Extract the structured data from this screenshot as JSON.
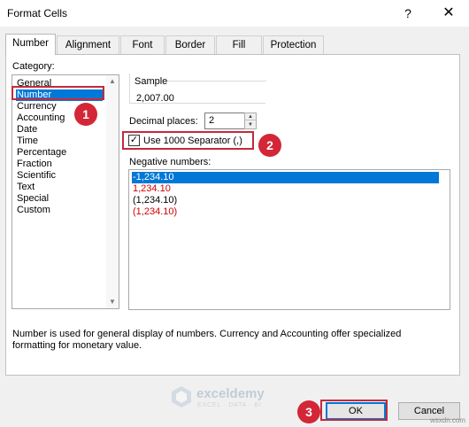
{
  "dialog": {
    "title": "Format Cells",
    "help": "?",
    "close": "✕"
  },
  "tabs": [
    {
      "label": "Number"
    },
    {
      "label": "Alignment"
    },
    {
      "label": "Font"
    },
    {
      "label": "Border"
    },
    {
      "label": "Fill"
    },
    {
      "label": "Protection"
    }
  ],
  "category": {
    "label": "Category:",
    "items": [
      "General",
      "Number",
      "Currency",
      "Accounting",
      "Date",
      "Time",
      "Percentage",
      "Fraction",
      "Scientific",
      "Text",
      "Special",
      "Custom"
    ],
    "selected": "Number"
  },
  "sample": {
    "label": "Sample",
    "value": "2,007.00"
  },
  "decimal": {
    "label": "Decimal places:",
    "value": "2"
  },
  "separator": {
    "label": "Use 1000 Separator (,)",
    "checked": true,
    "check_mark": "✓"
  },
  "negative": {
    "label": "Negative numbers:",
    "items": [
      "-1,234.10",
      "1,234.10",
      "(1,234.10)",
      "(1,234.10)"
    ],
    "selected_index": 0
  },
  "description": {
    "line1": "Number is used for general display of numbers.  Currency and Accounting offer specialized",
    "line2": "formatting for monetary value."
  },
  "buttons": {
    "ok": "OK",
    "cancel": "Cancel"
  },
  "annotations": {
    "badge1": "1",
    "badge2": "2",
    "badge3": "3"
  },
  "watermark": {
    "name": "exceldemy",
    "sub": "EXCEL · DATA · BI",
    "site": "wsxdn.com"
  },
  "colors": {
    "selection": "#0078d7",
    "highlight": "#c42a3c",
    "negative_red": "#d00000"
  }
}
